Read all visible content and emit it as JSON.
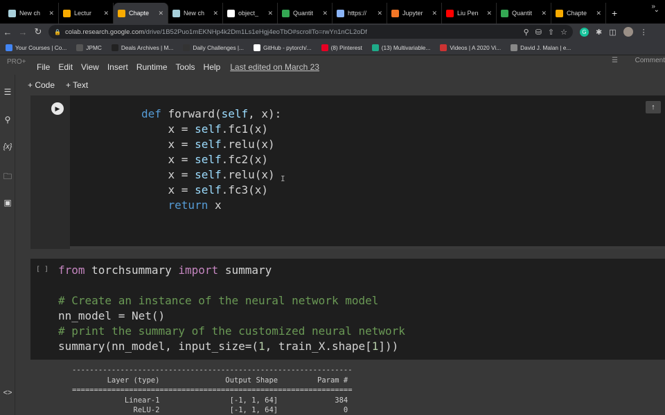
{
  "tabs": [
    {
      "label": "New ch",
      "icon": "colab-doc-icon",
      "color": "#a8d0db",
      "active": false
    },
    {
      "label": "Lectur",
      "icon": "colab-logo-icon",
      "color": "#f9ab00",
      "active": false
    },
    {
      "label": "Chapte",
      "icon": "colab-logo-icon",
      "color": "#f9ab00",
      "active": true
    },
    {
      "label": "New ch",
      "icon": "colab-doc-icon",
      "color": "#a8d0db",
      "active": false
    },
    {
      "label": "object_",
      "icon": "github-icon",
      "color": "#ffffff",
      "active": false
    },
    {
      "label": "Quantit",
      "icon": "drive-icon",
      "color": "#34a853",
      "active": false
    },
    {
      "label": "https://",
      "icon": "globe-icon",
      "color": "#8ab4f8",
      "active": false
    },
    {
      "label": "Jupyter",
      "icon": "jupyter-icon",
      "color": "#f37626",
      "active": false
    },
    {
      "label": "Liu Pen",
      "icon": "youtube-icon",
      "color": "#ff0000",
      "active": false
    },
    {
      "label": "Quantit",
      "icon": "drive-icon",
      "color": "#34a853",
      "active": false
    },
    {
      "label": "Chapte",
      "icon": "colab-logo-icon",
      "color": "#f9ab00",
      "active": false
    }
  ],
  "address": {
    "host": "colab.research.google.com",
    "path": "/drive/1B52Puo1mEKNHp4k2Dm1Ls1eHgj4eoTbO#scrollTo=rwYn1nCL2oDf"
  },
  "bookmarks": [
    {
      "label": "Your Courses | Co...",
      "color": "#4285f4"
    },
    {
      "label": "JPMC",
      "color": "#555555"
    },
    {
      "label": "Deals Archives | M...",
      "color": "#222222"
    },
    {
      "label": "Daily Challenges |...",
      "color": "#333333"
    },
    {
      "label": "GitHub - pytorch/...",
      "color": "#ffffff"
    },
    {
      "label": "(8) Pinterest",
      "color": "#e60023"
    },
    {
      "label": "(13) Multivariable...",
      "color": "#1fab89"
    },
    {
      "label": "Videos | A 2020 Vi...",
      "color": "#cc3333"
    },
    {
      "label": "David J. Malan | e...",
      "color": "#888888"
    }
  ],
  "colab": {
    "brand": "PRO+",
    "menu": [
      "File",
      "Edit",
      "View",
      "Insert",
      "Runtime",
      "Tools",
      "Help"
    ],
    "last_edited": "Last edited on March 23",
    "comment": "Comment",
    "add_code": "+ Code",
    "add_text": "+ Text"
  },
  "cell1": {
    "lines": [
      "def forward(self, x):",
      "    x = self.fc1(x)",
      "    x = self.relu(x)",
      "    x = self.fc2(x)",
      "    x = self.relu(x)",
      "    x = self.fc3(x)",
      "    return x"
    ]
  },
  "cell2": {
    "brackets": "[ ]",
    "lines": [
      "from torchsummary import summary",
      "",
      "# Create an instance of the neural network model",
      "nn_model = Net()",
      "# print the summary of the customized neural network",
      "summary(nn_model, input_size=(1, train_X.shape[1]))"
    ]
  },
  "output": {
    "rule1": "----------------------------------------------------------------",
    "header": "        Layer (type)               Output Shape         Param #",
    "rule2": "================================================================",
    "rows": [
      "            Linear-1                [-1, 1, 64]             384",
      "              ReLU-2                [-1, 1, 64]               0"
    ]
  }
}
